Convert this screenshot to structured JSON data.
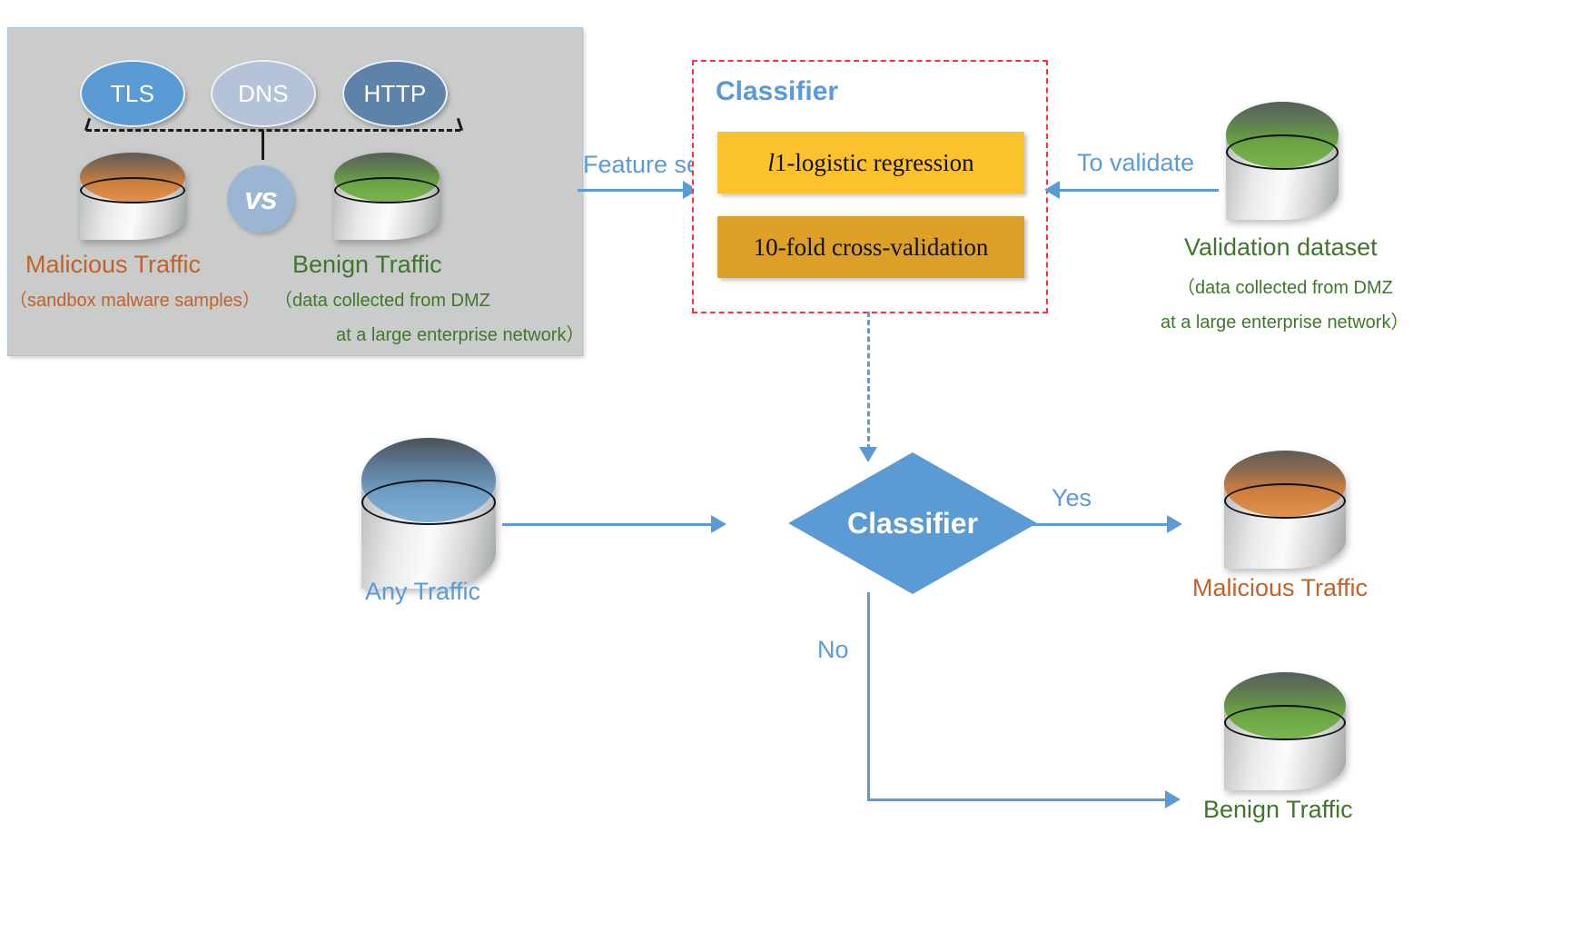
{
  "training_panel": {
    "protocols": [
      {
        "name": "TLS",
        "color": "#5b9bd5"
      },
      {
        "name": "DNS",
        "color": "#b4c3d8"
      },
      {
        "name": "HTTP",
        "color": "#5d83ab"
      }
    ],
    "vs_badge": "vs",
    "malicious": {
      "label": "Malicious Traffic",
      "sublabel": "（sandbox malware samples）",
      "color": "#c0622a"
    },
    "benign": {
      "label": "Benign Traffic",
      "sublabel_line1": "（data collected from DMZ",
      "sublabel_line2": "at a large enterprise network）",
      "color": "#40762c"
    }
  },
  "classifier_box": {
    "title": "Classifier",
    "title_color": "#5b9bd5",
    "border_color": "#ff2d45",
    "algorithms": [
      {
        "label_italic": "l",
        "label_rest": "1-logistic regression",
        "color": "#fcc22e"
      },
      {
        "label": "10-fold cross-validation",
        "color": "#dda026"
      }
    ]
  },
  "validation": {
    "label": "Validation dataset",
    "sublabel_line1": "（data collected from DMZ",
    "sublabel_line2": "at a large enterprise network）",
    "color": "#40762c"
  },
  "arrows": {
    "feature_sets": "Feature sets",
    "to_validate": "To validate",
    "yes": "Yes",
    "no": "No",
    "color": "#5b9bd5"
  },
  "decision": {
    "label": "Classifier",
    "color": "#5b9bd5"
  },
  "inference": {
    "input": {
      "label": "Any Traffic",
      "color": "#5b9bd5"
    },
    "output_yes": {
      "label": "Malicious Traffic",
      "color": "#c0622a"
    },
    "output_no": {
      "label": "Benign Traffic",
      "color": "#40762c"
    }
  }
}
